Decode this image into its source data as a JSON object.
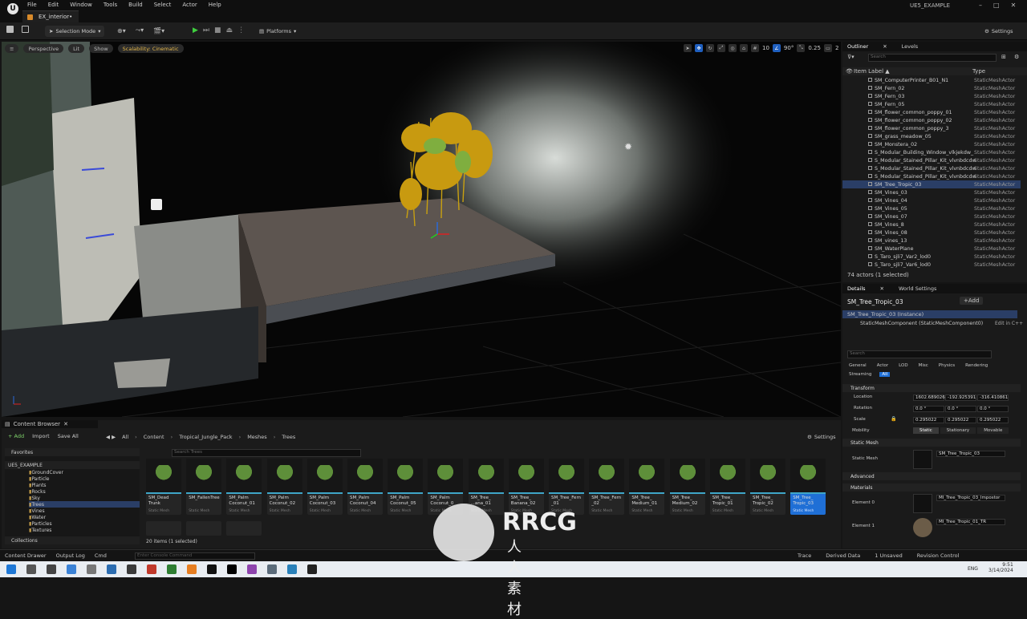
{
  "titlebar": {
    "menu": [
      "File",
      "Edit",
      "Window",
      "Tools",
      "Build",
      "Select",
      "Actor",
      "Help"
    ],
    "tab": "EX_interior•",
    "project": "UE5_EXAMPLE"
  },
  "toolbar": {
    "selection_mode": "Selection Mode",
    "platforms": "Platforms",
    "settings": "Settings"
  },
  "viewport": {
    "perspective": "Perspective",
    "lit": "Lit",
    "show": "Show",
    "scalability": "Scalability: Cinematic",
    "grid": "10",
    "angle": "90°",
    "scale": "0.25",
    "cams": "2"
  },
  "outliner": {
    "tab": "Outliner",
    "tab2": "Levels",
    "search_placeholder": "Search",
    "col_label": "Item Label ▲",
    "col_type": "Type",
    "rows": [
      {
        "name": "SM_ComputerPrinter_B01_N1",
        "type": "StaticMeshActor"
      },
      {
        "name": "SM_Fern_02",
        "type": "StaticMeshActor"
      },
      {
        "name": "SM_Fern_03",
        "type": "StaticMeshActor"
      },
      {
        "name": "SM_Fern_05",
        "type": "StaticMeshActor"
      },
      {
        "name": "SM_flower_common_poppy_01",
        "type": "StaticMeshActor"
      },
      {
        "name": "SM_flower_common_poppy_02",
        "type": "StaticMeshActor"
      },
      {
        "name": "SM_flower_common_poppy_3",
        "type": "StaticMeshActor"
      },
      {
        "name": "SM_grass_meadow_05",
        "type": "StaticMeshActor"
      },
      {
        "name": "SM_Monstera_02",
        "type": "StaticMeshActor"
      },
      {
        "name": "S_Modular_Building_Window_vlkjekdw_",
        "type": "StaticMeshActor"
      },
      {
        "name": "S_Modular_Stained_Pillar_Kit_vlvnbdcdw",
        "type": "StaticMeshActor"
      },
      {
        "name": "S_Modular_Stained_Pillar_Kit_vlvnbdcdw",
        "type": "StaticMeshActor"
      },
      {
        "name": "S_Modular_Stained_Pillar_Kit_vlvnbdcdw",
        "type": "StaticMeshActor"
      },
      {
        "name": "SM_Tree_Tropic_03",
        "type": "StaticMeshActor"
      },
      {
        "name": "SM_Vines_03",
        "type": "StaticMeshActor"
      },
      {
        "name": "SM_Vines_04",
        "type": "StaticMeshActor"
      },
      {
        "name": "SM_Vines_05",
        "type": "StaticMeshActor"
      },
      {
        "name": "SM_Vines_07",
        "type": "StaticMeshActor"
      },
      {
        "name": "SM_Vines_8",
        "type": "StaticMeshActor"
      },
      {
        "name": "SM_Vines_08",
        "type": "StaticMeshActor"
      },
      {
        "name": "SM_vines_13",
        "type": "StaticMeshActor"
      },
      {
        "name": "SM_WaterPlane",
        "type": "StaticMeshActor"
      },
      {
        "name": "S_Taro_sjli7_Var2_lod0",
        "type": "StaticMeshActor"
      },
      {
        "name": "S_Taro_sjli7_Var6_lod0",
        "type": "StaticMeshActor"
      }
    ],
    "count": "74 actors (1 selected)"
  },
  "details": {
    "tab": "Details",
    "tab2": "World Settings",
    "actor": "SM_Tree_Tropic_03",
    "add": "+Add",
    "instance": "SM_Tree_Tropic_03 (Instance)",
    "component": "StaticMeshComponent (StaticMeshComponent0)",
    "edit_cpp": "Edit in C++",
    "search_placeholder": "Search",
    "filters": [
      "General",
      "Actor",
      "LOD",
      "Misc",
      "Physics",
      "Rendering"
    ],
    "filters2": [
      "Streaming",
      "All"
    ],
    "transform": "Transform",
    "location": "Location",
    "loc": [
      "1602.689026",
      "-192.925391",
      "-316.410861"
    ],
    "rotation": "Rotation",
    "rot": [
      "0.0 °",
      "0.0 °",
      "0.0 °"
    ],
    "scale": "Scale",
    "scl": [
      "0.295022",
      "0.295022",
      "0.295022"
    ],
    "mobility": "Mobility",
    "mob": [
      "Static",
      "Stationary",
      "Movable"
    ],
    "static_mesh_section": "Static Mesh",
    "static_mesh_label": "Static Mesh",
    "static_mesh_value": "SM_Tree_Tropic_03",
    "advanced": "Advanced",
    "materials": "Materials",
    "element0": "Element 0",
    "mat0": "MI_Tree_Tropic_03_Impostor",
    "element1": "Element 1",
    "mat1": "MI_Tree_Tropic_01_TR"
  },
  "content_browser": {
    "tab": "Content Browser",
    "add": "+ Add",
    "import": "Import",
    "save_all": "Save All",
    "path": [
      "All",
      "Content",
      "Tropical_Jungle_Pack",
      "Meshes",
      "Trees"
    ],
    "settings": "Settings",
    "favorites": "Favorites",
    "project": "UE5_EXAMPLE",
    "folders": [
      "GroundCover",
      "Particle",
      "Plants",
      "Rocks",
      "Sky",
      "Trees",
      "Vines",
      "Water",
      "Particles",
      "Textures"
    ],
    "collections": "Collections",
    "search_placeholder": "Search Trees",
    "assets": [
      {
        "name": "SM_Dead Trunk",
        "sub": "Static Mesh"
      },
      {
        "name": "SM_FallenTree",
        "sub": "Static Mesh"
      },
      {
        "name": "SM_Palm Coconut_01",
        "sub": "Static Mesh"
      },
      {
        "name": "SM_Palm Coconut_02",
        "sub": "Static Mesh"
      },
      {
        "name": "SM_Palm Coconut_03",
        "sub": "Static Mesh"
      },
      {
        "name": "SM_Palm Coconut_04",
        "sub": "Static Mesh"
      },
      {
        "name": "SM_Palm Coconut_05",
        "sub": "Static Mesh"
      },
      {
        "name": "SM_Palm Coconut_0",
        "sub": "Static Mesh"
      },
      {
        "name": "SM_Tree_ ...ana_01",
        "sub": "Static Mesh"
      },
      {
        "name": "SM_Tree_ Banana_02",
        "sub": "Static Mesh"
      },
      {
        "name": "SM_Tree_Fern _01",
        "sub": "Static Mesh"
      },
      {
        "name": "SM_Tree_Fern _02",
        "sub": "Static Mesh"
      },
      {
        "name": "SM_Tree_ Medium_01",
        "sub": "Static Mesh"
      },
      {
        "name": "SM_Tree_ Medium_02",
        "sub": "Static Mesh"
      },
      {
        "name": "SM_Tree_ Tropic_01",
        "sub": "Static Mesh"
      },
      {
        "name": "SM_Tree_ Tropic_02",
        "sub": "Static Mesh"
      },
      {
        "name": "SM_Tree_ Tropic_03",
        "sub": "Static Mesh"
      }
    ],
    "count": "20 items (1 selected)"
  },
  "statusbar": {
    "content_drawer": "Content Drawer",
    "output_log": "Output Log",
    "cmd": "Cmd",
    "console_placeholder": "Enter Console Command",
    "trace": "Trace",
    "derived": "Derived Data",
    "unsaved": "1 Unsaved",
    "revision": "Revision Control"
  },
  "taskbar": {
    "lang": "ENG",
    "time": "9:51",
    "date": "3/14/2024"
  },
  "watermark": {
    "logo": "RRCG",
    "text": "人人素材"
  }
}
